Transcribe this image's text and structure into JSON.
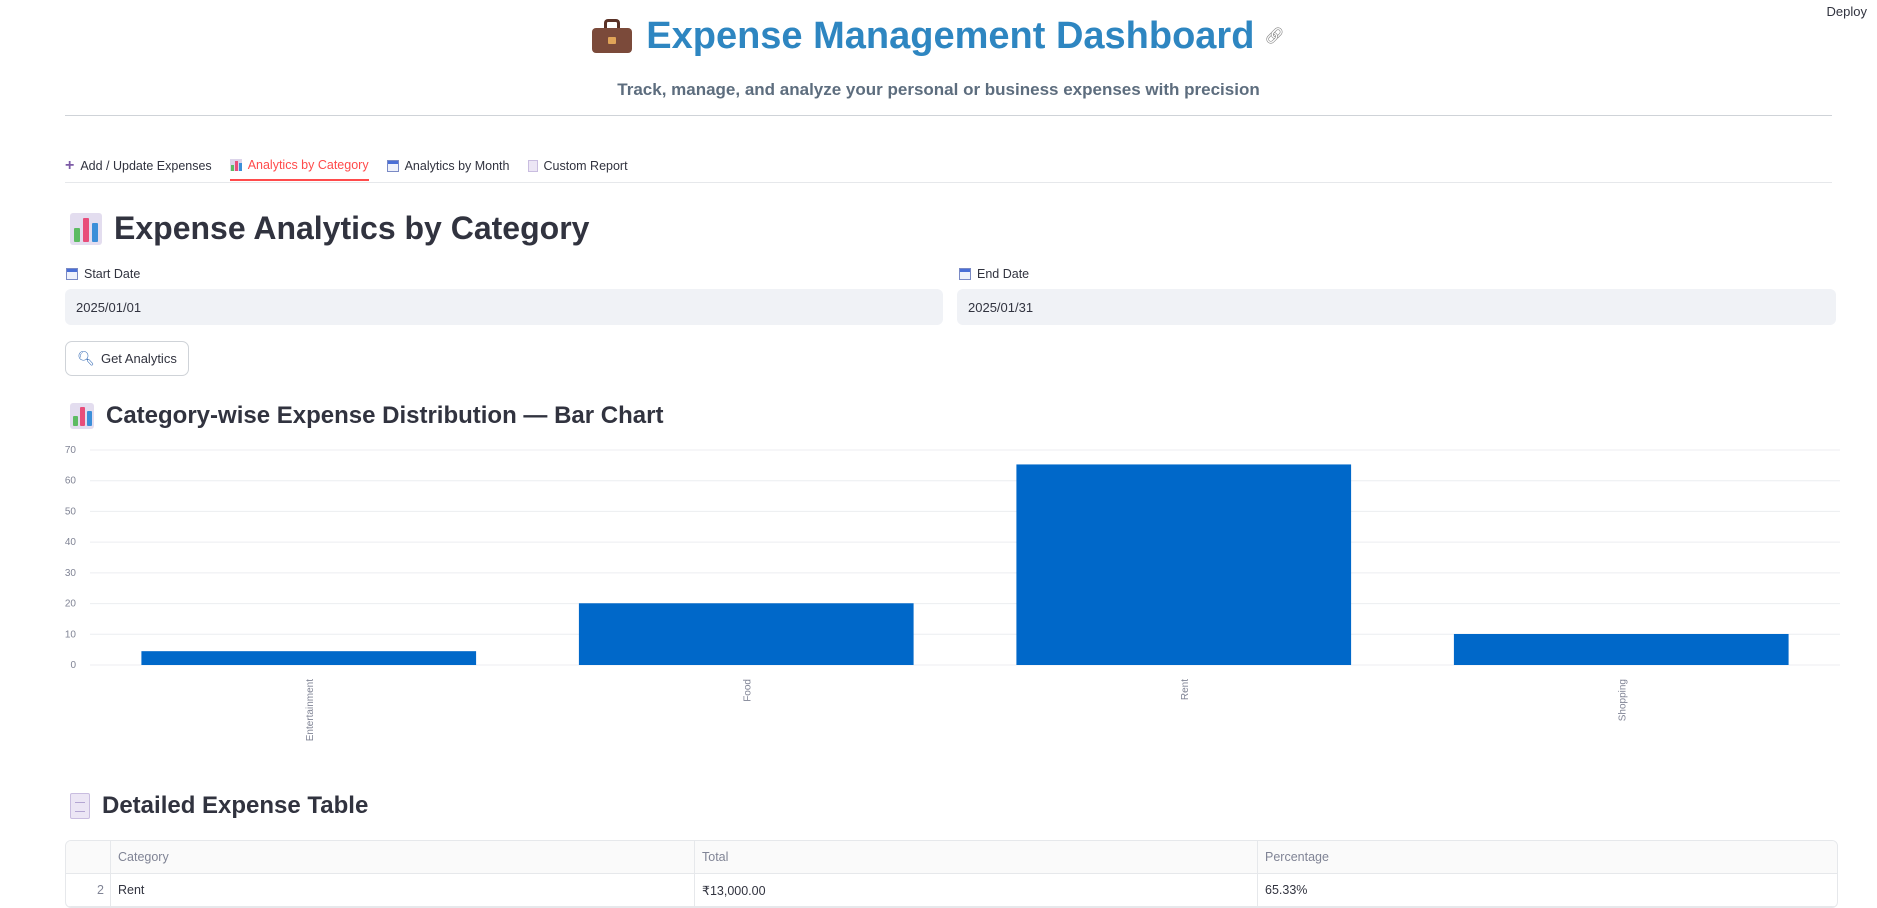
{
  "topbar": {
    "deploy_label": "Deploy"
  },
  "header": {
    "title": "Expense Management Dashboard",
    "subtitle": "Track, manage, and analyze your personal or business expenses with precision"
  },
  "tabs": [
    {
      "label": "Add / Update Expenses",
      "icon": "plus-icon",
      "active": false
    },
    {
      "label": "Analytics by Category",
      "icon": "bar-chart-icon",
      "active": true
    },
    {
      "label": "Analytics by Month",
      "icon": "calendar-icon",
      "active": false
    },
    {
      "label": "Custom Report",
      "icon": "document-icon",
      "active": false
    }
  ],
  "main": {
    "heading": "Expense Analytics by Category",
    "start_date": {
      "label": "Start Date",
      "value": "2025/01/01"
    },
    "end_date": {
      "label": "End Date",
      "value": "2025/01/31"
    },
    "get_button_label": "Get Analytics",
    "chart_heading": "Category-wise Expense Distribution — Bar Chart",
    "table_heading": "Detailed Expense Table"
  },
  "table": {
    "columns": [
      "",
      "Category",
      "Total",
      "Percentage"
    ],
    "rows": [
      {
        "index": "2",
        "category": "Rent",
        "total": "₹13,000.00",
        "percentage": "65.33%"
      }
    ]
  },
  "colors": {
    "accent": "#ff4b4b",
    "title": "#2e86c1",
    "bar": "#0068c9"
  },
  "chart_data": {
    "type": "bar",
    "categories": [
      "Entertainment",
      "Food",
      "Rent",
      "Shopping"
    ],
    "values": [
      4.5,
      20.1,
      65.3,
      10.1
    ],
    "title": "",
    "xlabel": "",
    "ylabel": "",
    "ylim": [
      0,
      70
    ],
    "yticks": [
      0,
      10,
      20,
      30,
      40,
      50,
      60,
      70
    ],
    "grid": true
  }
}
